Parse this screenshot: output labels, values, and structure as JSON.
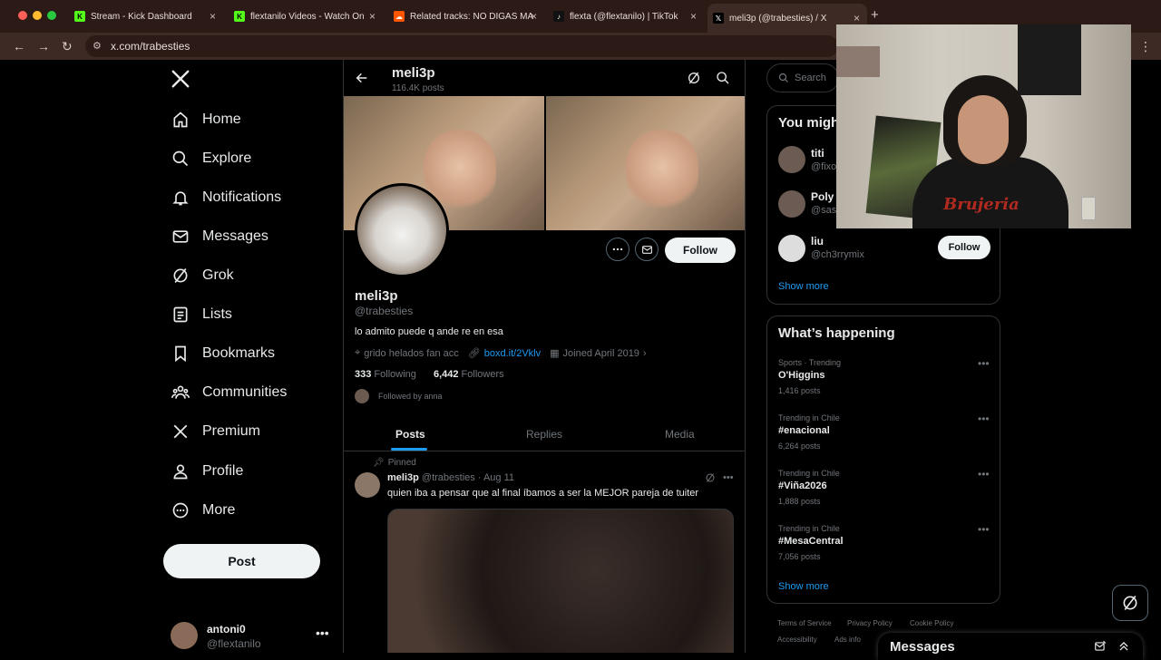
{
  "browser": {
    "tabs": [
      {
        "title": "Stream - Kick Dashboard",
        "icon": "kick-icon"
      },
      {
        "title": "flextanilo Videos - Watch On",
        "icon": "kick-icon"
      },
      {
        "title": "Related tracks: NO DIGAS MA",
        "icon": "soundcloud-icon"
      },
      {
        "title": "flexta (@flextanilo) | TikTok",
        "icon": "tiktok-icon"
      },
      {
        "title": "meli3p (@trabesties) / X",
        "icon": "x-icon"
      }
    ],
    "url": "x.com/trabesties"
  },
  "nav": {
    "items": [
      {
        "label": "Home",
        "icon": "home-icon"
      },
      {
        "label": "Explore",
        "icon": "search-icon"
      },
      {
        "label": "Notifications",
        "icon": "bell-icon"
      },
      {
        "label": "Messages",
        "icon": "mail-icon"
      },
      {
        "label": "Grok",
        "icon": "grok-icon"
      },
      {
        "label": "Lists",
        "icon": "list-icon"
      },
      {
        "label": "Bookmarks",
        "icon": "bookmark-icon"
      },
      {
        "label": "Communities",
        "icon": "communities-icon"
      },
      {
        "label": "Premium",
        "icon": "x-icon"
      },
      {
        "label": "Profile",
        "icon": "person-icon"
      },
      {
        "label": "More",
        "icon": "more-circle-icon"
      }
    ],
    "post_label": "Post",
    "account": {
      "name": "antoni0",
      "handle": "@flextanilo"
    }
  },
  "profile": {
    "header_name": "meli3p",
    "header_posts": "116.4K posts",
    "name": "meli3p",
    "handle": "@trabesties",
    "bio": "lo admito puede q ande re en esa",
    "location": "grido helados fan acc",
    "link": "boxd.it/2Vklv",
    "joined": "Joined April 2019",
    "following_count": "333",
    "following_label": "Following",
    "followers_count": "6,442",
    "followers_label": "Followers",
    "followed_by": "Followed by anna",
    "follow_label": "Follow",
    "tabs": [
      "Posts",
      "Replies",
      "Media"
    ]
  },
  "pinned_post": {
    "pinned_label": "Pinned",
    "author": "meli3p",
    "handle_date": "@trabesties · Aug 11",
    "text": "quien iba a pensar que al final íbamos a ser la MEJOR pareja de tuiter"
  },
  "sidebar": {
    "search_placeholder": "Search",
    "who_to_follow_title": "You migh",
    "suggestions": [
      {
        "name": "titi",
        "handle": "@fixo"
      },
      {
        "name": "Poly",
        "handle": "@sasa"
      },
      {
        "name": "liu",
        "handle": "@ch3rrymix",
        "follow": "Follow"
      }
    ],
    "show_more": "Show more",
    "trending_title": "What’s happening",
    "trends": [
      {
        "context": "Sports · Trending",
        "name": "O'Higgins",
        "count": "1,416 posts"
      },
      {
        "context": "Trending in Chile",
        "name": "#enacional",
        "count": "6,264 posts"
      },
      {
        "context": "Trending in Chile",
        "name": "#Viña2026",
        "count": "1,888 posts"
      },
      {
        "context": "Trending in Chile",
        "name": "#MesaCentral",
        "count": "7,056 posts"
      }
    ],
    "footer": [
      "Terms of Service",
      "Privacy Policy",
      "Cookie Policy",
      "Accessibility",
      "Ads info"
    ]
  },
  "messages_drawer": {
    "title": "Messages"
  },
  "webcam": {
    "shirt_text": "Brujeria"
  },
  "colors": {
    "accent": "#1d9bf0",
    "background": "#000000",
    "tabbar": "#2b1a16"
  }
}
